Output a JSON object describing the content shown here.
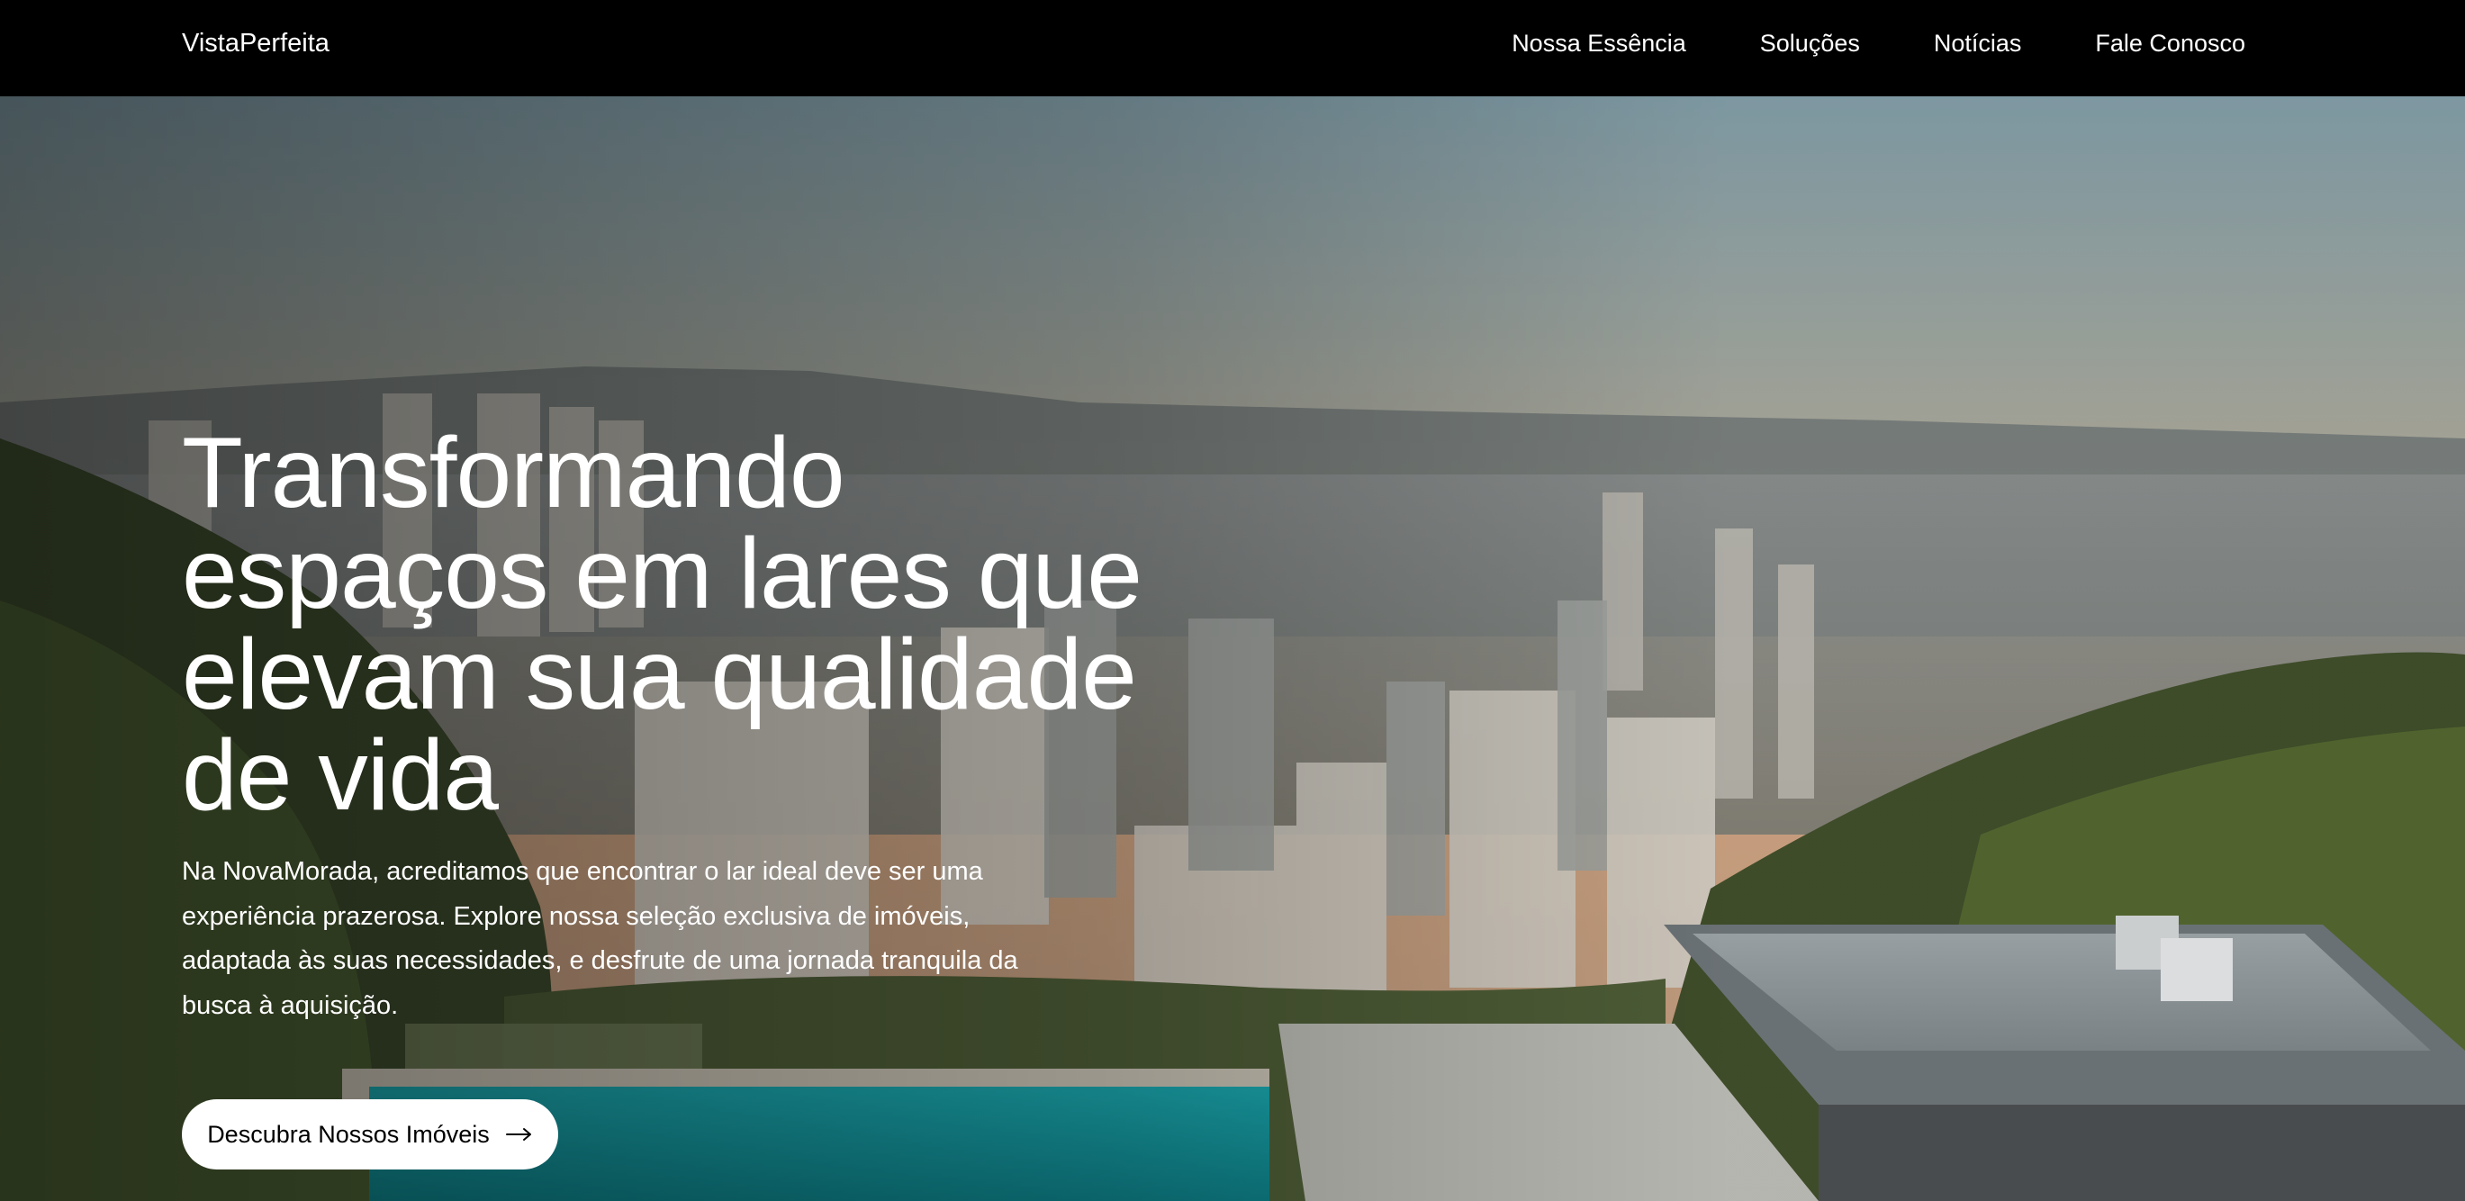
{
  "header": {
    "logo": "VistaPerfeita",
    "nav": [
      {
        "label": "Nossa Essência"
      },
      {
        "label": "Soluções"
      },
      {
        "label": "Notícias"
      },
      {
        "label": "Fale Conosco"
      }
    ]
  },
  "hero": {
    "title": "Transformando espaços em lares que elevam sua qualidade de vida",
    "description": "Na NovaMorada, acreditamos que encontrar o lar ideal deve ser uma experiência prazerosa. Explore nossa seleção exclusiva de imóveis, adaptada às suas necessidades, e desfrute de uma jornada tranquila da busca à aquisição.",
    "cta_label": "Descubra Nossos Imóveis",
    "cta_icon": "arrow-right-icon"
  },
  "colors": {
    "nav_background": "#000000",
    "text": "#ffffff",
    "button_background": "#ffffff",
    "button_text": "#000000"
  }
}
